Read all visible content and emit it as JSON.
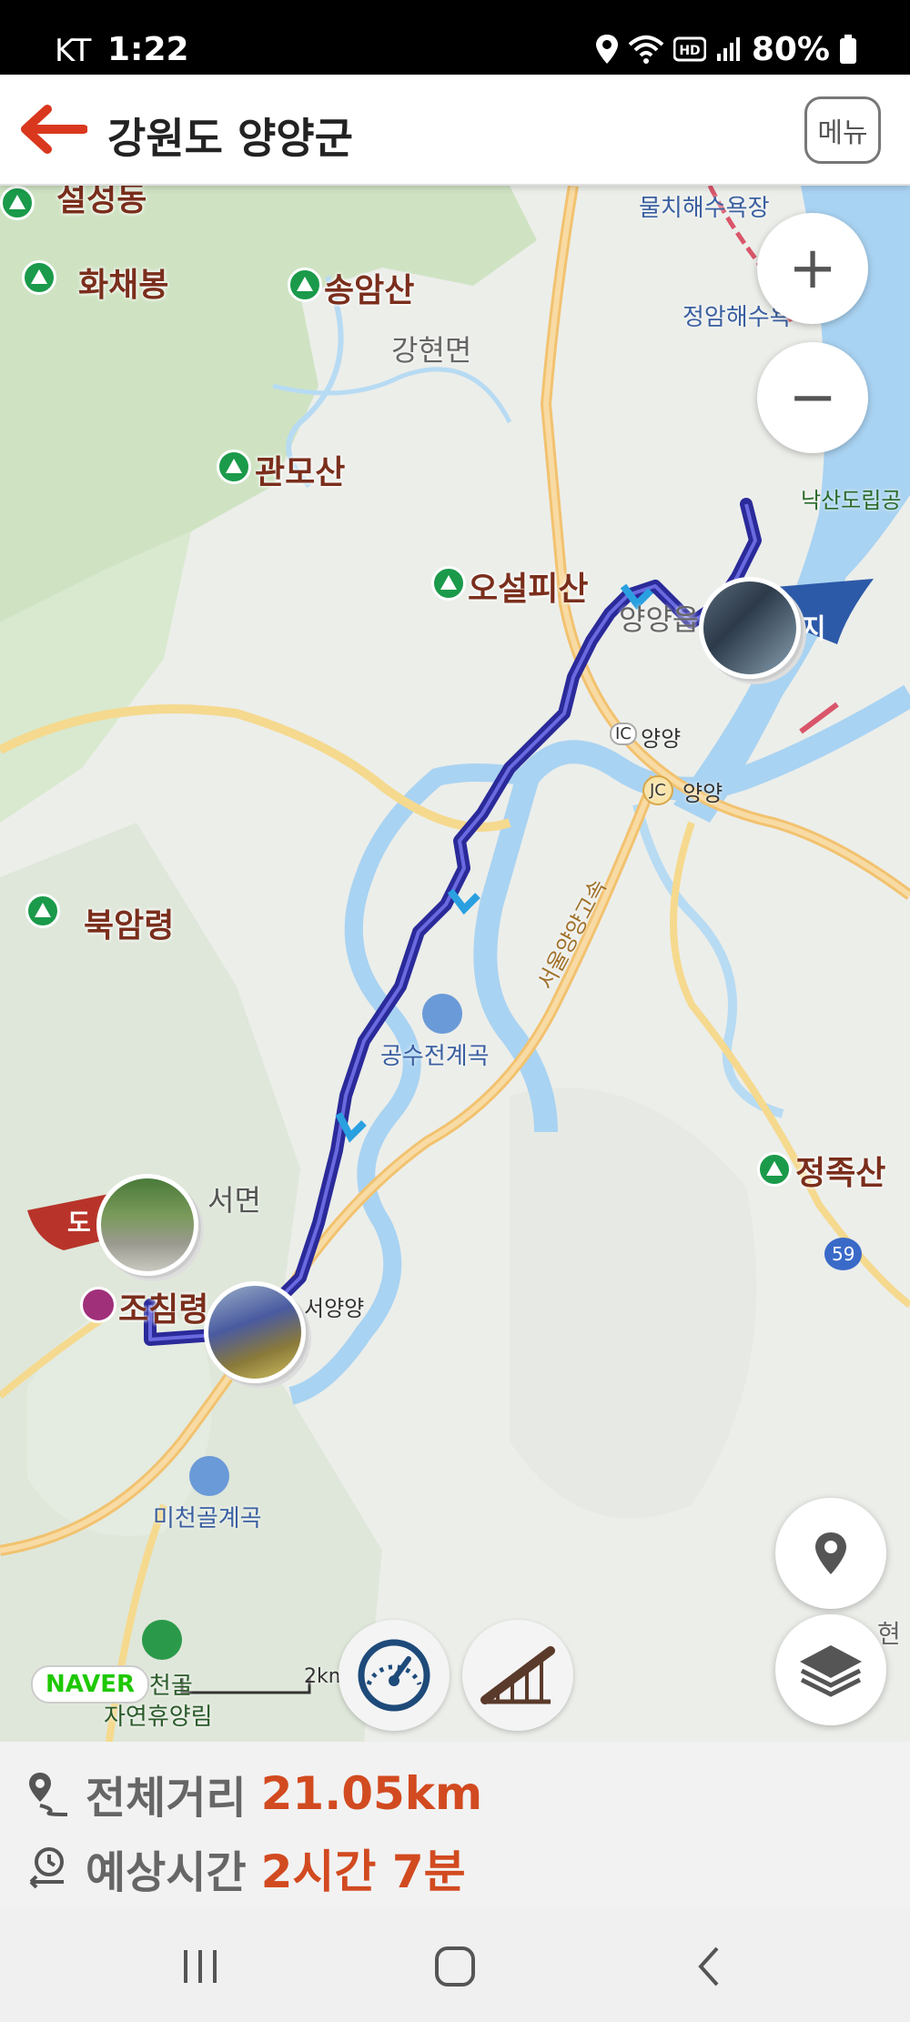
{
  "status_bar": {
    "carrier": "KT",
    "time": "1:22",
    "battery": "80%",
    "icons": [
      "location-icon",
      "wifi-6-icon",
      "hd-icon",
      "signal-icon",
      "battery-icon"
    ]
  },
  "header": {
    "back_icon": "arrow-left-icon",
    "title": "강원도 양양군",
    "menu_label": "메뉴"
  },
  "map": {
    "labels": {
      "seoraksan_partial": "설성동",
      "hwachaebong": "화채봉",
      "songamsan": "송암산",
      "ganghyeon": "강현면",
      "gwanmosan": "관모산",
      "oseolpisan": "오설피산",
      "yangyang_eup": "양양읍",
      "mulchi_beach": "물치해수욕장",
      "jeongam_beach": "정암해수욕",
      "naksan": "낙산도립공",
      "ic_yangyang": "양양",
      "jc_yangyang": "양양",
      "bugamryeong": "북암령",
      "gongsujeon": "공수전계곡",
      "highway": "서울양양고속",
      "seomyeon": "서면",
      "jochimryeong": "조침령",
      "seoyangyang": "서양양",
      "jeongjoksan": "정족산",
      "route59": "59",
      "micheongol": "미천골계곡",
      "micheongol_forest_1": "미천골",
      "micheongol_forest_2": "자연휴양림",
      "scale_label": "2km",
      "hyeon_partial": "현",
      "start_flag": "도",
      "end_flag": "지",
      "ic_badge": "IC",
      "jc_badge": "JC"
    },
    "naver_badge": "NAVER",
    "zoom_in": "+",
    "zoom_out": "−",
    "route_color": "#3a3ab8",
    "accent_color": "#d24a20"
  },
  "summary": {
    "distance_label": "전체거리",
    "distance_value": "21.05km",
    "time_label": "예상시간",
    "time_value": "2시간 7분"
  }
}
